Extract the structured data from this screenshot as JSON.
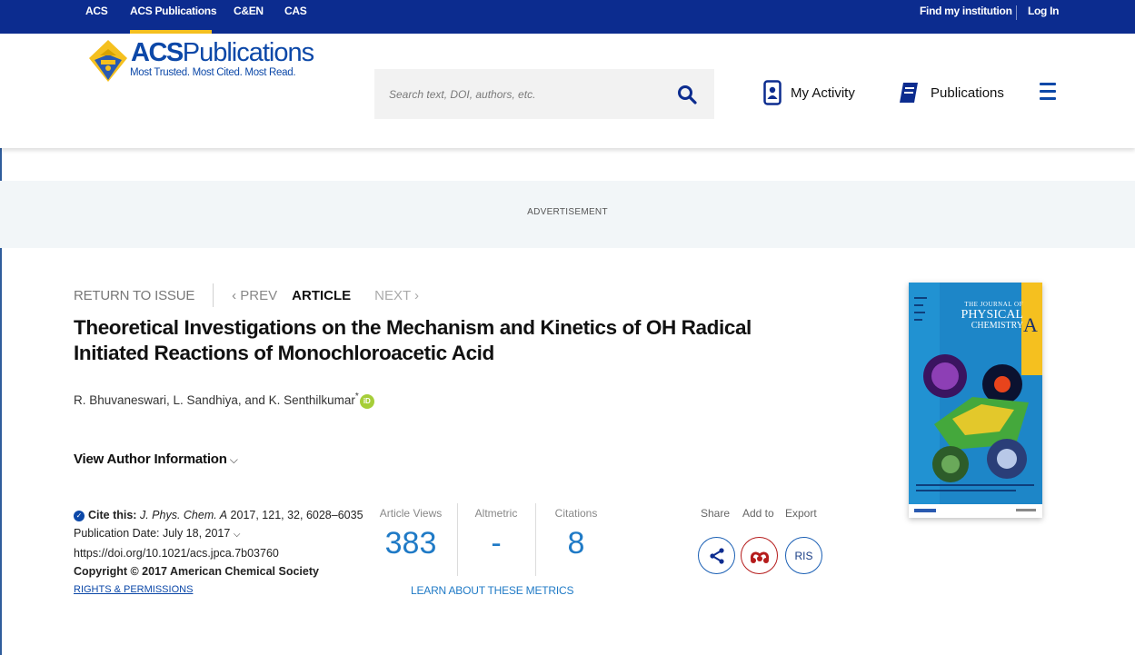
{
  "topbar": {
    "links": [
      "ACS",
      "ACS Publications",
      "C&EN",
      "CAS"
    ],
    "right_links": [
      "Find my institution",
      "Log In"
    ]
  },
  "header": {
    "logo_name_bold": "ACS",
    "logo_name_rest": "Publications",
    "logo_tagline": "Most Trusted. Most Cited. Most Read.",
    "search_placeholder": "Search text, DOI, authors, etc.",
    "my_activity": "My Activity",
    "publications": "Publications"
  },
  "ad": {
    "label": "ADVERTISEMENT"
  },
  "article_nav": {
    "return": "RETURN TO ISSUE",
    "prev": "‹ PREV",
    "current": "ARTICLE",
    "next": "NEXT ›"
  },
  "article": {
    "title": "Theoretical Investigations on the Mechanism and Kinetics of OH Radical Initiated Reactions of Monochloroacetic Acid",
    "authors": "R. Bhuvaneswari, L. Sandhiya, and K. Senthilkumar",
    "author_star": "*",
    "orcid": "iD",
    "view_author": "View Author Information",
    "view_author_chevron": "⌵"
  },
  "cite": {
    "label": "Cite this:",
    "journal": "J. Phys. Chem. A",
    "details": "2017, 121, 32, 6028–6035",
    "pub_date": "Publication Date: July 18, 2017",
    "pub_date_chevron": "⌵",
    "doi": "https://doi.org/10.1021/acs.jpca.7b03760",
    "copyright": "Copyright © 2017 American Chemical Society",
    "rights": "RIGHTS & PERMISSIONS"
  },
  "metrics": {
    "views_label": "Article Views",
    "views_value": "383",
    "altmetric_label": "Altmetric",
    "altmetric_value": "-",
    "citations_label": "Citations",
    "citations_value": "8",
    "learn": "LEARN ABOUT THESE METRICS"
  },
  "actions": {
    "share": "Share",
    "add_to": "Add to",
    "export": "Export",
    "ris": "RIS"
  },
  "cover": {
    "journal_line1": "THE JOURNAL OF",
    "journal_line2": "PHYSICAL",
    "journal_line3": "CHEMISTRY",
    "letter": "A"
  },
  "colors": {
    "topbar": "#0c2c8f",
    "accent_yellow": "#f5c01f",
    "brand_blue": "#0c48a8",
    "metric_blue": "#1f7ac6",
    "mendeley_red": "#b51c1c",
    "cover_blue": "#1d86c8"
  }
}
